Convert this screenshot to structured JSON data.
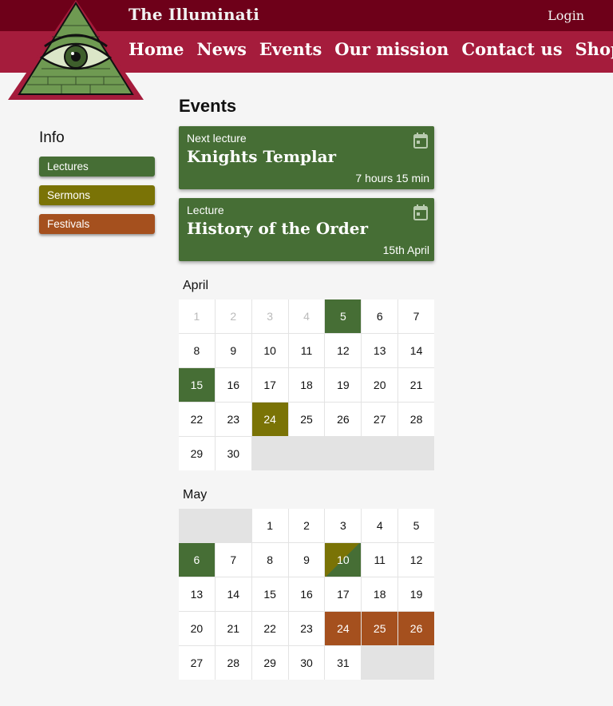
{
  "header": {
    "site_title": "The Illuminati",
    "login_label": "Login",
    "nav": [
      "Home",
      "News",
      "Events",
      "Our mission",
      "Contact us",
      "Shop"
    ]
  },
  "colors": {
    "top_bar": "#6e0019",
    "nav_bar": "#a51c3c",
    "lecture": "#466e35",
    "sermon": "#7a7306",
    "festival": "#a5501e"
  },
  "sidebar": {
    "heading": "Info",
    "legend": [
      {
        "label": "Lectures",
        "kind": "lecture"
      },
      {
        "label": "Sermons",
        "kind": "sermon"
      },
      {
        "label": "Festivals",
        "kind": "festival"
      }
    ]
  },
  "main": {
    "heading": "Events",
    "cards": [
      {
        "type": "Next lecture",
        "title": "Knights Templar",
        "when": "7 hours 15 min",
        "icon": "calendar-icon"
      },
      {
        "type": "Lecture",
        "title": "History of the Order",
        "when": "15th April",
        "icon": "calendar-icon"
      }
    ]
  },
  "calendar": [
    {
      "month": "April",
      "days": [
        {
          "n": "1",
          "s": "muted"
        },
        {
          "n": "2",
          "s": "muted"
        },
        {
          "n": "3",
          "s": "muted"
        },
        {
          "n": "4",
          "s": "muted"
        },
        {
          "n": "5",
          "s": "lec"
        },
        {
          "n": "6",
          "s": ""
        },
        {
          "n": "7",
          "s": ""
        },
        {
          "n": "8",
          "s": ""
        },
        {
          "n": "9",
          "s": ""
        },
        {
          "n": "10",
          "s": ""
        },
        {
          "n": "11",
          "s": ""
        },
        {
          "n": "12",
          "s": ""
        },
        {
          "n": "13",
          "s": ""
        },
        {
          "n": "14",
          "s": ""
        },
        {
          "n": "15",
          "s": "lec"
        },
        {
          "n": "16",
          "s": ""
        },
        {
          "n": "17",
          "s": ""
        },
        {
          "n": "18",
          "s": ""
        },
        {
          "n": "19",
          "s": ""
        },
        {
          "n": "20",
          "s": ""
        },
        {
          "n": "21",
          "s": ""
        },
        {
          "n": "22",
          "s": ""
        },
        {
          "n": "23",
          "s": ""
        },
        {
          "n": "24",
          "s": "ser"
        },
        {
          "n": "25",
          "s": ""
        },
        {
          "n": "26",
          "s": ""
        },
        {
          "n": "27",
          "s": ""
        },
        {
          "n": "28",
          "s": ""
        },
        {
          "n": "29",
          "s": ""
        },
        {
          "n": "30",
          "s": ""
        },
        {
          "n": "",
          "s": "empty"
        },
        {
          "n": "",
          "s": "empty"
        },
        {
          "n": "",
          "s": "empty"
        },
        {
          "n": "",
          "s": "empty"
        },
        {
          "n": "",
          "s": "empty"
        }
      ]
    },
    {
      "month": "May",
      "days": [
        {
          "n": "",
          "s": "empty"
        },
        {
          "n": "",
          "s": "empty"
        },
        {
          "n": "1",
          "s": ""
        },
        {
          "n": "2",
          "s": ""
        },
        {
          "n": "3",
          "s": ""
        },
        {
          "n": "4",
          "s": ""
        },
        {
          "n": "5",
          "s": ""
        },
        {
          "n": "6",
          "s": "lec"
        },
        {
          "n": "7",
          "s": ""
        },
        {
          "n": "8",
          "s": ""
        },
        {
          "n": "9",
          "s": ""
        },
        {
          "n": "10",
          "s": "split"
        },
        {
          "n": "11",
          "s": ""
        },
        {
          "n": "12",
          "s": ""
        },
        {
          "n": "13",
          "s": ""
        },
        {
          "n": "14",
          "s": ""
        },
        {
          "n": "15",
          "s": ""
        },
        {
          "n": "16",
          "s": ""
        },
        {
          "n": "17",
          "s": ""
        },
        {
          "n": "18",
          "s": ""
        },
        {
          "n": "19",
          "s": ""
        },
        {
          "n": "20",
          "s": ""
        },
        {
          "n": "21",
          "s": ""
        },
        {
          "n": "22",
          "s": ""
        },
        {
          "n": "23",
          "s": ""
        },
        {
          "n": "24",
          "s": "fes"
        },
        {
          "n": "25",
          "s": "fes"
        },
        {
          "n": "26",
          "s": "fes"
        },
        {
          "n": "27",
          "s": ""
        },
        {
          "n": "28",
          "s": ""
        },
        {
          "n": "29",
          "s": ""
        },
        {
          "n": "30",
          "s": ""
        },
        {
          "n": "31",
          "s": ""
        },
        {
          "n": "",
          "s": "empty"
        },
        {
          "n": "",
          "s": "empty"
        }
      ]
    }
  ]
}
